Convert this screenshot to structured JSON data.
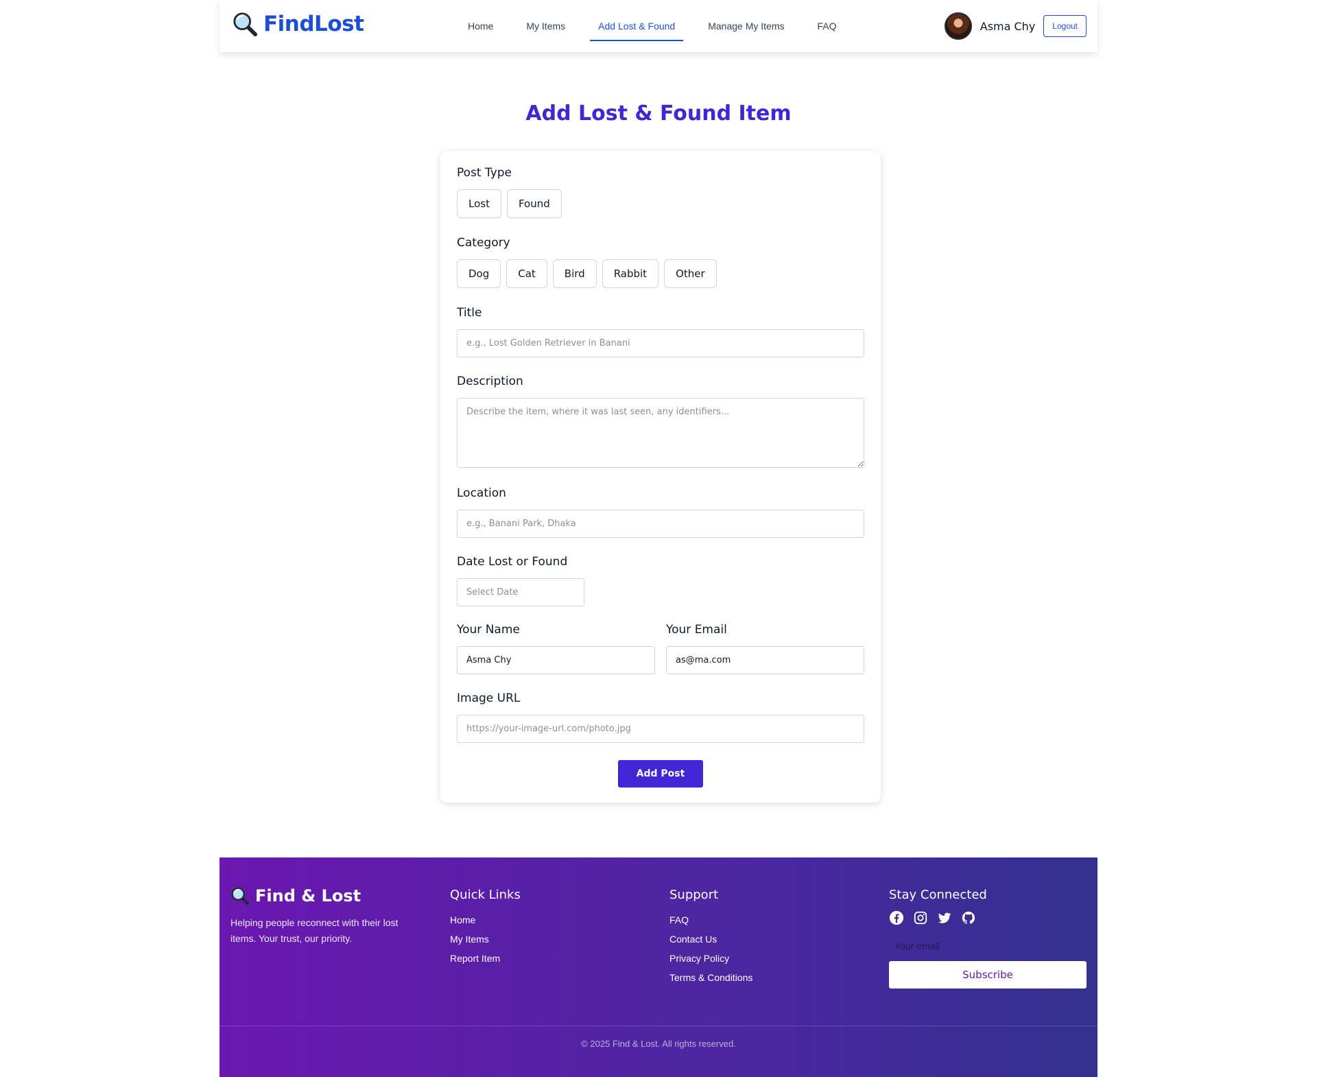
{
  "nav": {
    "brand": "FindLost",
    "links": [
      {
        "label": "Home",
        "active": false
      },
      {
        "label": "My Items",
        "active": false
      },
      {
        "label": "Add Lost & Found",
        "active": true
      },
      {
        "label": "Manage My Items",
        "active": false
      },
      {
        "label": "FAQ",
        "active": false
      }
    ],
    "user_name": "Asma Chy",
    "logout_label": "Logout"
  },
  "page": {
    "title": "Add Lost & Found Item"
  },
  "form": {
    "post_type": {
      "label": "Post Type",
      "options": [
        "Lost",
        "Found"
      ]
    },
    "category": {
      "label": "Category",
      "options": [
        "Dog",
        "Cat",
        "Bird",
        "Rabbit",
        "Other"
      ]
    },
    "title": {
      "label": "Title",
      "placeholder": "e.g., Lost Golden Retriever in Banani",
      "value": ""
    },
    "description": {
      "label": "Description",
      "placeholder": "Describe the item, where it was last seen, any identifiers...",
      "value": ""
    },
    "location": {
      "label": "Location",
      "placeholder": "e.g., Banani Park, Dhaka",
      "value": ""
    },
    "date": {
      "label": "Date Lost or Found",
      "placeholder": "Select Date",
      "value": ""
    },
    "name": {
      "label": "Your Name",
      "value": "Asma Chy"
    },
    "email": {
      "label": "Your Email",
      "value": "as@ma.com"
    },
    "image_url": {
      "label": "Image URL",
      "placeholder": "https://your-image-url.com/photo.jpg",
      "value": ""
    },
    "submit_label": "Add Post"
  },
  "footer": {
    "brand": "Find & Lost",
    "tagline": "Helping people reconnect with their lost items. Your trust, our priority.",
    "quick_links": {
      "title": "Quick Links",
      "items": [
        "Home",
        "My Items",
        "Report Item"
      ]
    },
    "support": {
      "title": "Support",
      "items": [
        "FAQ",
        "Contact Us",
        "Privacy Policy",
        "Terms & Conditions"
      ]
    },
    "stay_connected": {
      "title": "Stay Connected",
      "socials": [
        "facebook-icon",
        "instagram-icon",
        "twitter-icon",
        "github-icon"
      ],
      "email_placeholder": "Your email",
      "subscribe_label": "Subscribe"
    },
    "copyright": "© 2025 Find & Lost. All rights reserved."
  },
  "colors": {
    "brand_blue": "#1d4ed8",
    "accent_purple": "#4226d6",
    "footer_start": "#6b17b0",
    "footer_end": "#33308e"
  }
}
